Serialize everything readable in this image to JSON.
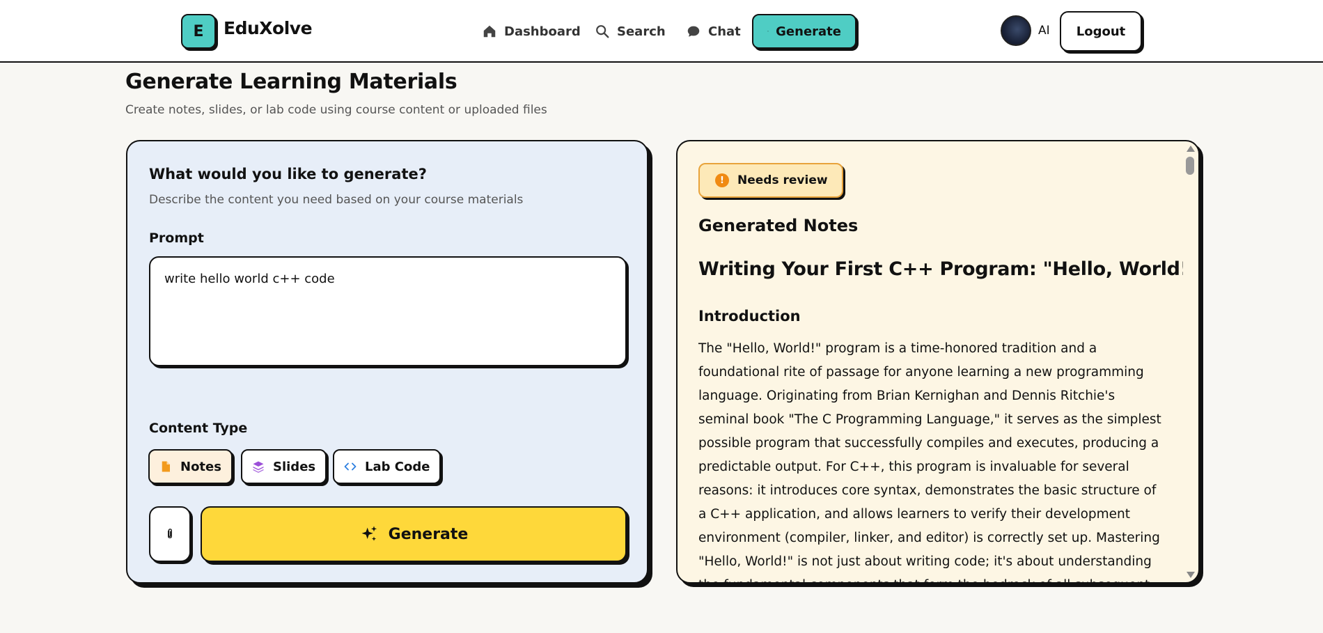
{
  "nav": {
    "logo_letter": "E",
    "brand": "EduXolve",
    "links": [
      {
        "label": "Dashboard",
        "icon": "home-icon"
      },
      {
        "label": "Search",
        "icon": "search-icon"
      },
      {
        "label": "Chat",
        "icon": "chat-icon"
      },
      {
        "label": "Generate",
        "icon": "sparkles-icon",
        "active": true
      }
    ],
    "user_initials": "AI",
    "logout_label": "Logout"
  },
  "header": {
    "title": "Generate Learning Materials",
    "subtitle": "Create notes, slides, or lab code using course content or uploaded files"
  },
  "form": {
    "title": "What would you like to generate?",
    "subtitle": "Describe the content you need based on your course materials",
    "prompt_label": "Prompt",
    "prompt_value": "write hello world c++ code",
    "content_type_label": "Content Type",
    "content_types": [
      {
        "label": "Notes",
        "icon": "file-icon",
        "selected": true
      },
      {
        "label": "Slides",
        "icon": "layers-icon",
        "selected": false
      },
      {
        "label": "Lab Code",
        "icon": "code-icon",
        "selected": false
      }
    ],
    "attach_icon": "paperclip-icon",
    "generate_label": "Generate"
  },
  "output": {
    "badge": "Needs review",
    "badge_icon": "exclamation-icon",
    "section_title": "Generated Notes",
    "doc_title": "Writing Your First C++ Program: \"Hello, World!\"",
    "doc_heading": "Introduction",
    "doc_paragraph": "The \"Hello, World!\" program is a time-honored tradition and a foundational rite of passage for anyone learning a new programming language. Originating from Brian Kernighan and Dennis Ritchie's seminal book \"The C Programming Language,\" it serves as the simplest possible program that successfully compiles and executes, producing a predictable output. For C++, this program is invaluable for several reasons: it introduces core syntax, demonstrates the basic structure of a C++ application, and allows learners to verify their development environment (compiler, linker, and editor) is correctly set up. Mastering \"Hello, World!\" is not just about writing code; it's about understanding the fundamental components that form the bedrock of all subsequent C++ development."
  },
  "colors": {
    "accent_teal": "#4fcdc4",
    "generate_yellow": "#fed83a",
    "form_bg": "#e7eef8",
    "output_bg": "#fdf6e4",
    "warning_orange": "#f08a12"
  }
}
